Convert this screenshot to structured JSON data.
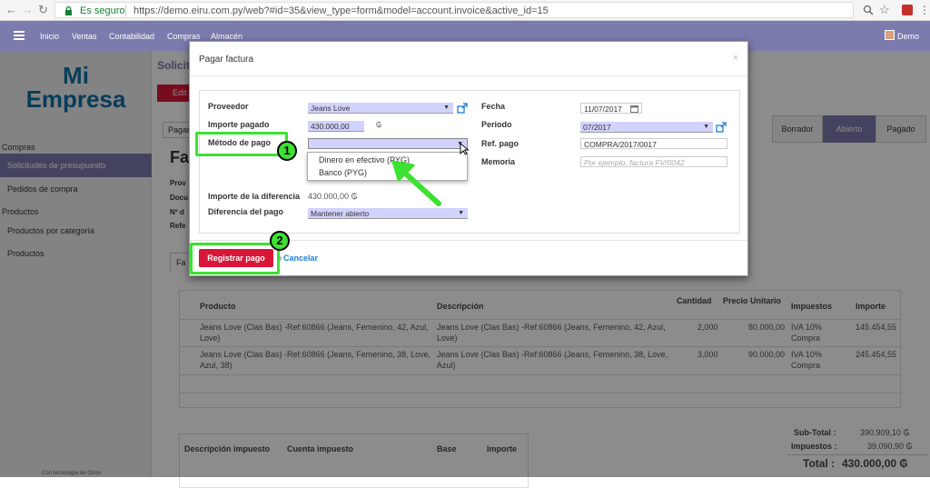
{
  "browser": {
    "secure_label": "Es seguro",
    "url": "https://demo.eiru.com.py/web?#id=35&view_type=form&model=account.invoice&active_id=15"
  },
  "nav": {
    "items": [
      "Inicio",
      "Ventas",
      "Contabilidad",
      "Compras",
      "Almacén"
    ],
    "user": "Demo"
  },
  "sidebar": {
    "logo_line1": "Mi",
    "logo_line2": "Empresa",
    "section_compras": "Compras",
    "items_compras": [
      "Solicitudes de presupuesto",
      "Pedidos de compra"
    ],
    "section_productos": "Productos",
    "items_productos": [
      "Productos por categoría",
      "Productos"
    ],
    "footer": "Con tecnología de Odoo"
  },
  "background": {
    "breadcrumb": "Solicit",
    "edit_btn": "Edit",
    "pay_tab": "Pagar",
    "title_partial": "Fa",
    "left_labels": [
      "Prov",
      "Docu",
      "Nº d",
      "Refe"
    ],
    "tab_partial": "Fa",
    "statusbar": [
      "Borrador",
      "Abierto",
      "Pagado"
    ],
    "table_headers": [
      "Producto",
      "Descripción",
      "Cantidad",
      "Precio Unitario",
      "Impuestos",
      "Importe"
    ],
    "rows": [
      {
        "product": "Jeans Love (Clas Bas) -Ref:60866 (Jeans, Femenino, 42, Azul, Love)",
        "description": "Jeans Love (Clas Bas) -Ref:60866 (Jeans, Femenino, 42, Azul, Love)",
        "qty": "2,000",
        "price": "80.000,00",
        "tax": "IVA 10% Compra",
        "amount": "145.454,55"
      },
      {
        "product": "Jeans Love (Clas Bas) -Ref:60866 (Jeans, Femenino, 38, Love, Azul, 38)",
        "description": "Jeans Love (Clas Bas) -Ref:60866 (Jeans, Femenino, 38, Love, Azul)",
        "qty": "3,000",
        "price": "90.000,00",
        "tax": "IVA 10% Compra",
        "amount": "245.454,55"
      }
    ],
    "tax_headers": [
      "Descripción impuesto",
      "Cuenta impuesto",
      "Base",
      "Importe"
    ],
    "subtotal_label": "Sub-Total :",
    "subtotal_value": "390.909,10 ₲",
    "taxes_label": "Impuestos :",
    "taxes_value": "39.090,90 ₲",
    "total_label": "Total :",
    "total_value": "430.000,00 ₲"
  },
  "modal": {
    "title": "Pagar factura",
    "close": "×",
    "labels": {
      "proveedor": "Proveedor",
      "importe_pagado": "Importe pagado",
      "metodo_pago": "Método de pago",
      "importe_diferencia": "Importe de la diferencia",
      "diferencia_pago": "Diferencia del pago",
      "fecha": "Fecha",
      "periodo": "Periodo",
      "ref_pago": "Ref. pago",
      "memoria": "Memoria"
    },
    "values": {
      "proveedor": "Jeans Love",
      "importe_pagado": "430.000,00",
      "currency_symbol": "₲",
      "metodo_pago": "",
      "importe_diferencia": "430.000,00 ₲",
      "diferencia_pago": "Mantener abierto",
      "fecha": "11/07/2017",
      "periodo": "07/2017",
      "ref_pago": "COMPRA/2017/0017",
      "memoria_placeholder": "Por ejemplo, factura FV/0042"
    },
    "dropdown_options": [
      "Dinero en efectivo (PYG)",
      "Banco (PYG)"
    ],
    "register_button": "Registrar pago",
    "or_text": "o",
    "cancel_link": "Cancelar"
  },
  "annotations": {
    "badge1": "1",
    "badge2": "2"
  },
  "colors": {
    "nav": "#7c7bad",
    "logo": "#0e6fa5",
    "register": "#d9163a",
    "highlight": "#3de132",
    "field": "#d2d2ff"
  }
}
